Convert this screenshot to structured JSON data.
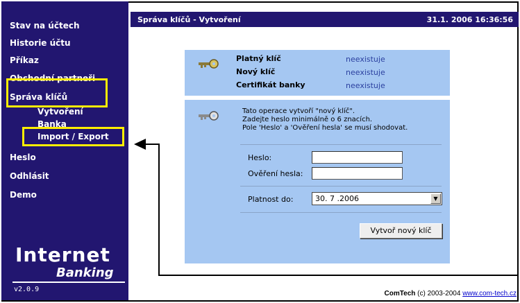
{
  "sidebar": {
    "items": [
      {
        "label": "Stav na účtech"
      },
      {
        "label": "Historie účtu"
      },
      {
        "label": "Příkaz"
      },
      {
        "label": "Obchodní partneři"
      },
      {
        "label": "Správa klíčů"
      },
      {
        "label": "Vytvoření"
      },
      {
        "label": "Banka"
      },
      {
        "label": "Import / Export"
      },
      {
        "label": "Heslo"
      },
      {
        "label": "Odhlásit"
      },
      {
        "label": "Demo"
      }
    ],
    "logo_line1": "Internet",
    "logo_line2": "Banking",
    "version": "v2.0.9"
  },
  "header": {
    "title": "Správa klíčů - Vytvoření",
    "datetime": "31.1. 2006  16:36:56"
  },
  "status": {
    "rows": [
      {
        "label": "Platný klíč",
        "value": "neexistuje"
      },
      {
        "label": "Nový klíč",
        "value": "neexistuje"
      },
      {
        "label": "Certifikát banky",
        "value": "neexistuje"
      }
    ]
  },
  "form": {
    "info_lines": [
      "Tato operace vytvoří \"nový klíč\".",
      "Zadejte heslo minimálně o 6 znacích.",
      "Pole 'Heslo' a 'Ověření hesla' se musí shodovat."
    ],
    "password_label": "Heslo:",
    "password_value": "",
    "confirm_label": "Ověření hesla:",
    "confirm_value": "",
    "validity_label": "Platnost do:",
    "validity_value": "30. 7 .2006",
    "submit_label": "Vytvoř nový klíč"
  },
  "footer": {
    "brand": "ComTech",
    "copyright": " (c) 2003-2004 ",
    "link": "www.com-tech.cz"
  },
  "colors": {
    "sidebar_bg": "#221670",
    "panel_bg": "#a5c7f2",
    "highlight": "#ffee00",
    "value_text": "#2a3f9f"
  }
}
